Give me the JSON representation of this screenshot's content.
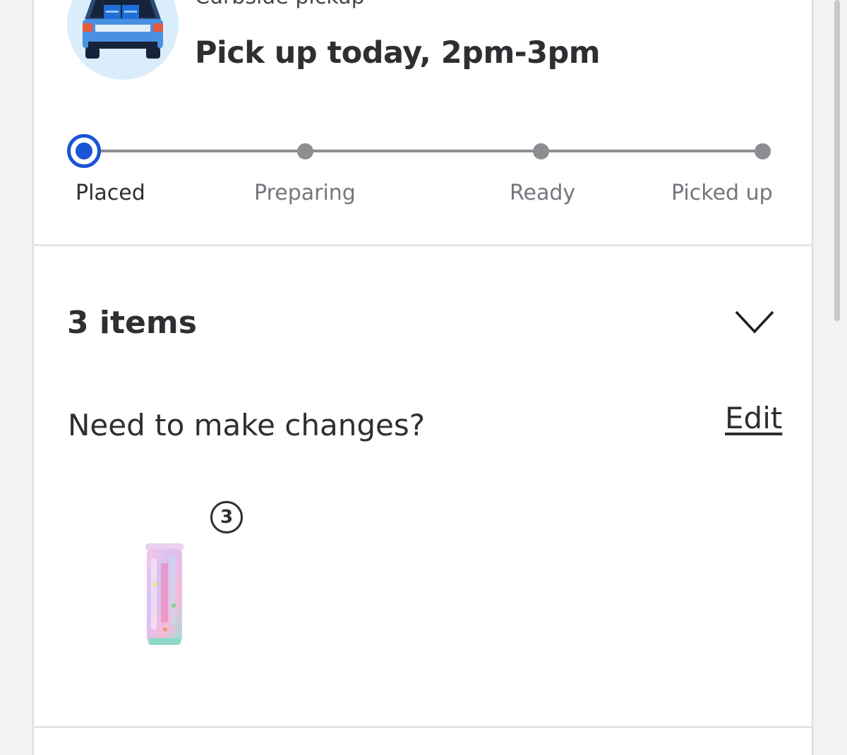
{
  "header": {
    "pickup_type": "Curbside pickup",
    "pickup_time": "Pick up today, 2pm-3pm",
    "hero_icon": "car-trunk-with-bags-icon"
  },
  "tracker": {
    "current_step": 0,
    "steps": [
      {
        "label": "Placed"
      },
      {
        "label": "Preparing"
      },
      {
        "label": "Ready"
      },
      {
        "label": "Picked up"
      }
    ],
    "active_color": "#1a55d6",
    "inactive_color": "#8d8d92"
  },
  "items": {
    "title": "3 items",
    "toggle_icon": "chevron-down-icon",
    "changes_prompt": "Need to make changes?",
    "edit_label": "Edit",
    "products": [
      {
        "quantity": "3",
        "image_icon": "tumbler-product-image"
      }
    ]
  }
}
